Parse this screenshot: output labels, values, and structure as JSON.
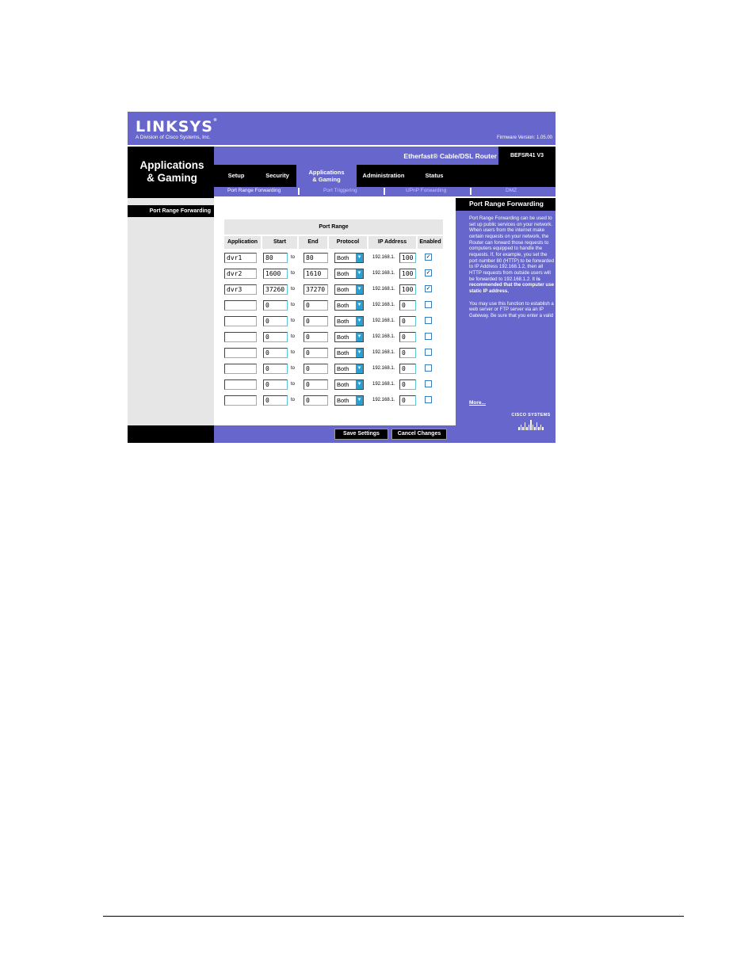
{
  "header": {
    "logo": "LINKSYS",
    "logo_mark": "®",
    "subtitle": "A Division of Cisco Systems, Inc.",
    "firmware": "Firmware Version: 1.05.00",
    "section_title_line1": "Applications",
    "section_title_line2": "& Gaming",
    "product_name": "Etherfast® Cable/DSL Router",
    "model": "BEFSR41 V3"
  },
  "tabs": [
    {
      "label": "Setup"
    },
    {
      "label": "Security"
    },
    {
      "label": "Applications",
      "label2": "& Gaming"
    },
    {
      "label": "Administration"
    },
    {
      "label": "Status"
    }
  ],
  "subtabs": [
    {
      "label": "Port Range Forwarding"
    },
    {
      "label": "Port Triggering"
    },
    {
      "label": "UPnP Forwarding"
    },
    {
      "label": "DMZ"
    }
  ],
  "sidebar": {
    "heading": "Port Range Forwarding"
  },
  "table": {
    "title": "Port Range",
    "columns": [
      "Application",
      "Start",
      "End",
      "Protocol",
      "IP Address",
      "Enabled"
    ],
    "to_label": "to",
    "ip_prefix": "192.168.1.",
    "rows": [
      {
        "app": "dvr1",
        "start": "80",
        "end": "80",
        "protocol": "Both",
        "ip": "100",
        "enabled": "✓"
      },
      {
        "app": "dvr2",
        "start": "1600",
        "end": "1610",
        "protocol": "Both",
        "ip": "100",
        "enabled": "✓"
      },
      {
        "app": "dvr3",
        "start": "37260",
        "end": "37270",
        "protocol": "Both",
        "ip": "100",
        "enabled": "✓"
      },
      {
        "app": "",
        "start": "0",
        "end": "0",
        "protocol": "Both",
        "ip": "0",
        "enabled": ""
      },
      {
        "app": "",
        "start": "0",
        "end": "0",
        "protocol": "Both",
        "ip": "0",
        "enabled": ""
      },
      {
        "app": "",
        "start": "0",
        "end": "0",
        "protocol": "Both",
        "ip": "0",
        "enabled": ""
      },
      {
        "app": "",
        "start": "0",
        "end": "0",
        "protocol": "Both",
        "ip": "0",
        "enabled": ""
      },
      {
        "app": "",
        "start": "0",
        "end": "0",
        "protocol": "Both",
        "ip": "0",
        "enabled": ""
      },
      {
        "app": "",
        "start": "0",
        "end": "0",
        "protocol": "Both",
        "ip": "0",
        "enabled": ""
      },
      {
        "app": "",
        "start": "0",
        "end": "0",
        "protocol": "Both",
        "ip": "0",
        "enabled": ""
      }
    ]
  },
  "help": {
    "title": "Port Range Forwarding",
    "text": "Port Range Forwarding can be used to set up public services on your network. When users from the internet make certain requests on your network, the Router can forward those requests to computers equipped to handle the requests. If, for example, you set the port number 80 (HTTP) to be forwarded to IP Address 192.168.1.2, then all HTTP requests from outside users will be forwarded to 192.168.1.2. It",
    "bold_text": "is recommended that the computer use static IP address.",
    "text2": "You may use this function to establish a web server or FTP server via an IP Gateway. Be sure that you enter a valid",
    "more": "More...",
    "cisco": "CISCO SYSTEMS"
  },
  "buttons": {
    "save": "Save Settings",
    "cancel": "Cancel Changes"
  }
}
